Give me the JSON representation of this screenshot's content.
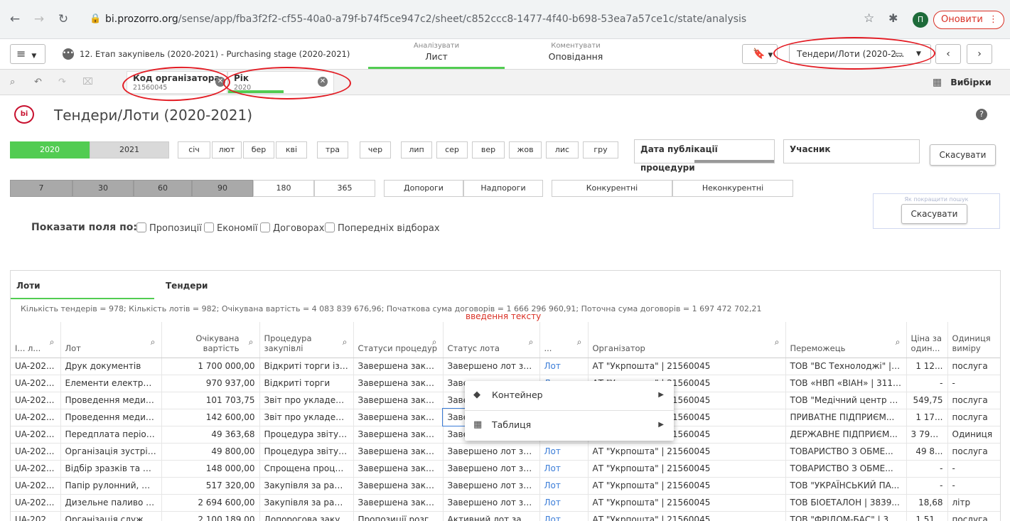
{
  "browser": {
    "back_icon": "arrow-left-icon",
    "url_host": "bi.prozorro.org",
    "url_path": "/sense/app/fba3f2f2-cf55-40a0-a79f-b74f5ce947c2/sheet/c852ccc8-1477-4f40-b698-53ea7a57ce1c/state/analysis",
    "avatar_letter": "П",
    "update_label": "Оновити"
  },
  "toolbar": {
    "app_title": "12. Етап закупівель (2020-2021) - Purchasing stage (2020-2021)",
    "analyze_small": "Аналізувати",
    "analyze_big": "Лист",
    "story_small": "Коментувати",
    "story_big": "Оповідання",
    "sheet_select": "Тендери/Лоти (2020-2..."
  },
  "selections": {
    "chips": [
      {
        "field": "Код організатора",
        "value": "21560045"
      },
      {
        "field": "Рік",
        "value": "2020"
      }
    ],
    "selections_label": "Вибірки"
  },
  "sheet": {
    "logo_text": "bi",
    "title": "Тендери/Лоти (2020-2021)"
  },
  "filters": {
    "years": [
      "2020",
      "2021"
    ],
    "months": [
      "січ",
      "лют",
      "бер",
      "кві",
      "тра",
      "чер",
      "лип",
      "сер",
      "вер",
      "жов",
      "лис",
      "гру"
    ],
    "publication_date_label": "Дата публікації процедури",
    "participant_label": "Учасник",
    "cancel_label": "Скасувати",
    "days": [
      "7",
      "30",
      "60",
      "90",
      "180",
      "365"
    ],
    "threshold": [
      "Допороги",
      "Надпороги"
    ],
    "competition": [
      "Конкурентні",
      "Неконкурентні"
    ],
    "hint_text": "Як покращити пошук",
    "cancel_label_2": "Скасувати",
    "show_fields_label": "Показати поля по:",
    "checkboxes": [
      "Пропозиції",
      "Економії",
      "Договорах",
      "Попередніх відборах"
    ]
  },
  "table": {
    "tabs": [
      "Лоти",
      "Тендери"
    ],
    "summary": "Кількість тендерів = 978; Кількість лотів = 982; Очікувана вартість = 4 083 839 676,96; Початкова сума договорів = 1 666 296 960,91; Поточна сума договорів = 1 697 472 702,21",
    "text_input_label": "введення тексту",
    "columns": [
      "І... л...",
      "Лот",
      "Очікувана вартість",
      "Процедура закупівлі",
      "Статуси процедур",
      "Статус лота",
      "...",
      "Організатор",
      "Переможець",
      "Ціна за один...",
      "Одиниця виміру"
    ],
    "rows": [
      [
        "UA-202...",
        "Друк документів",
        "1 700 000,00",
        "Відкриті торги із п...",
        "Завершена закупі...",
        "Завершено лот зак...",
        "Лот",
        "АТ \"Укрпошта\" | 21560045",
        "ТОВ \"ВС Технолоджі\" | 3...",
        "1 12...",
        "послуга"
      ],
      [
        "UA-202...",
        "Елементи електрич...",
        "970 937,00",
        "Відкриті торги",
        "Завершена закупі...",
        "Завершено лот зак...",
        "Лот",
        "АТ \"Укрпошта\" | 21560045",
        "ТОВ «НВП «ВІАН» | 3116...",
        "-",
        "-"
      ],
      [
        "UA-202...",
        "Проведення медич...",
        "101 703,75",
        "Звіт про укладени...",
        "Завершена закупі...",
        "Завершено лот зак...",
        "Лот",
        "АТ \"Укрпошта\" | 21560045",
        "ТОВ \"Медічний центр \"М...",
        "549,75",
        "послуга"
      ],
      [
        "UA-202...",
        "Проведення медич...",
        "142 600,00",
        "Звіт про укладени...",
        "Завершена закупі...",
        "Завершено лот зак...",
        "Лот",
        "АТ \"Укрпошта\" | 21560045",
        "ПРИВАТНЕ ПІДПРИЄМ...",
        "1 17...",
        "послуга"
      ],
      [
        "UA-202...",
        "Передплата період...",
        "49 363,68",
        "Процедура звітува...",
        "Завершена закупі...",
        "Завершено лот зак...",
        "Лот",
        "АТ \"Укрпошта\" | 21560045",
        "ДЕРЖАВНЕ ПІДПРИЄМ...",
        "3 797...",
        "Одиниця"
      ],
      [
        "UA-202...",
        "Організація зустрічі...",
        "49 800,00",
        "Процедура звітува...",
        "Завершена закупі...",
        "Завершено лот зак...",
        "Лот",
        "АТ \"Укрпошта\" | 21560045",
        "ТОВАРИСТВО З ОБМЕ...",
        "49 8...",
        "послуга"
      ],
      [
        "UA-202...",
        "Відбір зразків та пр...",
        "148 000,00",
        "Спрощена процед...",
        "Завершена закупі...",
        "Завершено лот зак...",
        "Лот",
        "АТ \"Укрпошта\" | 21560045",
        "ТОВАРИСТВО З ОБМЕ...",
        "-",
        "-"
      ],
      [
        "UA-202...",
        "Папір рулонний, фа...",
        "517 320,00",
        "Закупівля за рамко...",
        "Завершена закупі...",
        "Завершено лот зак...",
        "Лот",
        "АТ \"Укрпошта\" | 21560045",
        "ТОВ \"УКРАЇНСЬКИЙ ПА...",
        "-",
        "-"
      ],
      [
        "UA-202...",
        "Дизельне паливо д...",
        "2 694 600,00",
        "Закупівля за рамко...",
        "Завершена закупі...",
        "Завершено лот зак...",
        "Лот",
        "АТ \"Укрпошта\" | 21560045",
        "ТОВ БІОЕТАЛОН | 3839...",
        "18,68",
        "літр"
      ],
      [
        "UA-202...",
        "Організація службо...",
        "2 100 189,00",
        "Допорогова закупі...",
        "Пропозиції розгл...",
        "Активний лот закуп...",
        "Лот",
        "АТ \"Укрпошта\" | 21560045",
        "ТОВ \"ФРІДОМ-БАС\" | 39...",
        "1 51...",
        "послуга"
      ]
    ]
  },
  "context_menu": {
    "items": [
      {
        "label": "Контейнер",
        "icon": "container-icon"
      },
      {
        "label": "Таблиця",
        "icon": "table-icon"
      }
    ]
  },
  "colors": {
    "accent_green": "#52cc52",
    "annotation_red": "#e31b23",
    "link_blue": "#3b7dd8"
  }
}
